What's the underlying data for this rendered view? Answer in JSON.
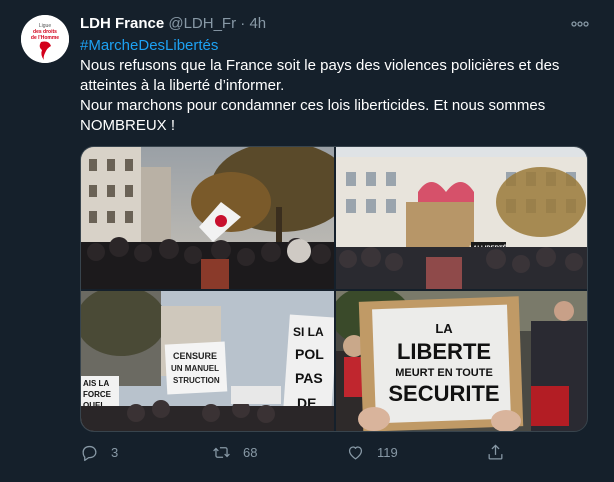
{
  "account": {
    "display_name": "LDH France",
    "handle": "@LDH_Fr",
    "separator": "·",
    "time": "4h",
    "avatar_logo_text": [
      "Ligue",
      "des droits",
      "de l'Homme"
    ]
  },
  "tweet": {
    "hashtag": "#MarcheDesLibertés",
    "lines": [
      "Nous refusons que la France soit le pays des violences policières et des atteintes à la liberté d’informer.",
      "Nour marchons pour condamner ces lois liberticides. Et nous sommes NOMBREUX !"
    ]
  },
  "media": {
    "photos": [
      {
        "name": "photo-crowd-flag",
        "sign_text": []
      },
      {
        "name": "photo-heart-sign",
        "sign_text": [
          "LALLIBERTÉ"
        ]
      },
      {
        "name": "photo-banners",
        "sign_text": [
          "CENSURE",
          "UN MANUEL",
          "STRUCTION",
          "AIS LA",
          "FORCE",
          "QUEL",
          "SI LA",
          "POL",
          "PAS",
          "DE"
        ]
      },
      {
        "name": "photo-liberte-sign",
        "sign_text": [
          "LA",
          "LIBERTE",
          "MEURT EN TOUTE",
          "SECURITE"
        ]
      }
    ]
  },
  "actions": {
    "reply_count": "3",
    "retweet_count": "68",
    "like_count": "119"
  },
  "colors": {
    "background": "#15202b",
    "link": "#1da1f2",
    "muted": "#8899a6"
  }
}
